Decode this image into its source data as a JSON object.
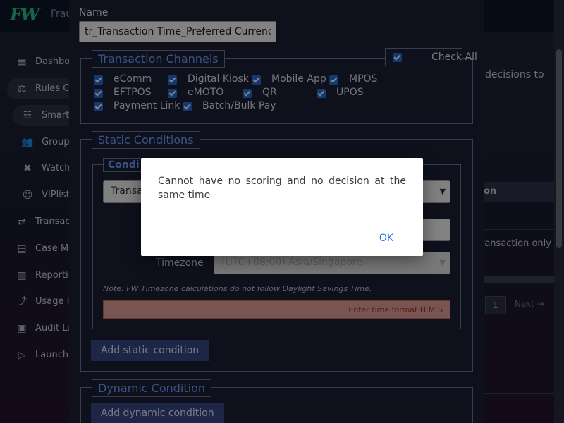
{
  "app": {
    "brand": "Frau"
  },
  "sidebar": {
    "items": [
      {
        "label": "Dashbo",
        "icon": "dashboard-icon"
      },
      {
        "label": "Rules C",
        "icon": "rules-icon"
      },
      {
        "label": "Smart",
        "icon": "smart-rules-icon"
      },
      {
        "label": "Group",
        "icon": "group-icon"
      },
      {
        "label": "Watch",
        "icon": "watchlist-icon"
      },
      {
        "label": "VIPlist",
        "icon": "viplist-icon"
      },
      {
        "label": "Transac",
        "icon": "transactions-icon"
      },
      {
        "label": "Case Ma",
        "icon": "case-management-icon"
      },
      {
        "label": "Reportin",
        "icon": "reporting-icon"
      },
      {
        "label": "Usage H",
        "icon": "usage-history-icon"
      },
      {
        "label": "Audit Lo",
        "icon": "audit-log-icon"
      },
      {
        "label": "Launch",
        "icon": "launch-icon"
      }
    ]
  },
  "right_pane": {
    "text": "decisions to",
    "table_header": "on",
    "row_text": "ransaction only",
    "page": "1",
    "next": "Next →"
  },
  "form": {
    "name_label": "Name",
    "name_value": "tr_Transaction Time_Preferred Currency",
    "channels": {
      "legend": "Transaction Channels",
      "check_all_label": "Check All",
      "options": [
        "eComm",
        "Digital Kiosk",
        "Mobile App",
        "MPOS",
        "EFTPOS",
        "eMOTO",
        "QR",
        "UPOS",
        "Payment Link",
        "Batch/Bulk Pay"
      ]
    },
    "static": {
      "legend": "Static Conditions",
      "condition_legend": "Condi",
      "condition_select_value": "Transa",
      "timezone_label": "Timezone",
      "timezone_value": "(UTC+08:00) Asia/Singapore",
      "note": "Note: FW Timezone calculations do not follow Daylight Savings Time.",
      "time_error": "Enter time format H:M:S",
      "add_button": "Add static condition"
    },
    "dynamic": {
      "legend": "Dynamic Condition",
      "add_button": "Add dynamic condition"
    }
  },
  "dialog": {
    "message": "Cannot have no scoring and no decision at the same time",
    "ok_label": "OK"
  },
  "colors": {
    "accent": "#6fa0ff",
    "checkbox": "#2470d8",
    "button": "#3a4a8a",
    "error_bg": "#e8a39d",
    "ok_link": "#1a73e8"
  }
}
